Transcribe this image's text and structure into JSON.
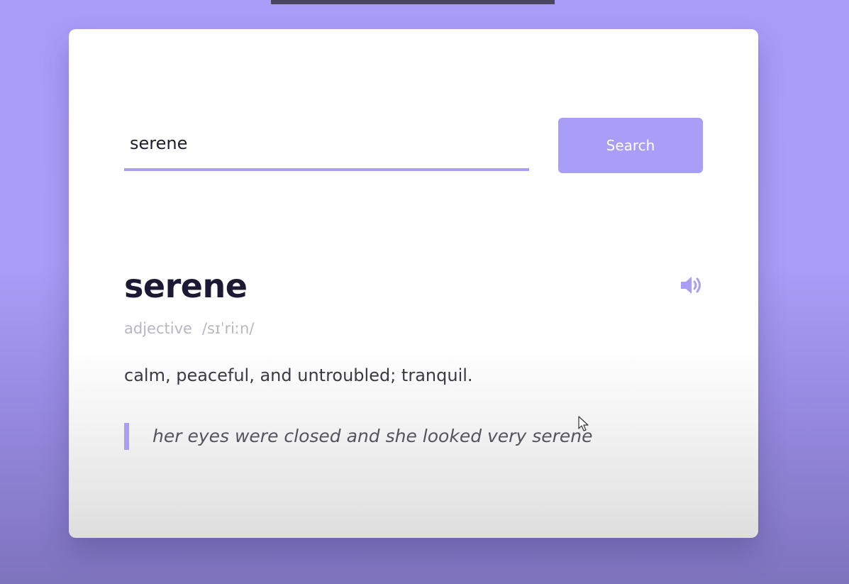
{
  "search": {
    "value": "serene",
    "button_label": "Search"
  },
  "entry": {
    "word": "serene",
    "part_of_speech": "adjective",
    "phonetic": "/sɪˈriːn/",
    "definition": "calm, peaceful, and untroubled; tranquil.",
    "example": "her eyes were closed and she looked very serene"
  },
  "icons": {
    "audio": "speaker-icon",
    "pointer": "mouse-cursor-icon"
  },
  "colors": {
    "accent": "#a99ef7",
    "background": "#a89cf8",
    "heading": "#1c1934",
    "muted": "#b8b6c2"
  }
}
